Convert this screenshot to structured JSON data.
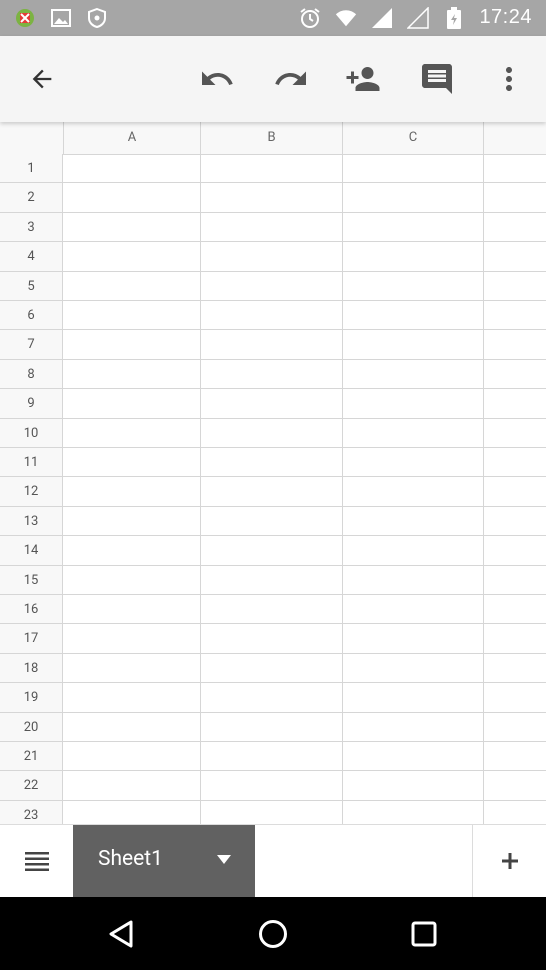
{
  "status_bar": {
    "time": "17:24",
    "left_icons": [
      "app-notification-icon",
      "image-notification-icon",
      "shield-notification-icon"
    ],
    "right_icons": [
      "alarm-icon",
      "wifi-icon",
      "signal-icon",
      "battery-icon"
    ]
  },
  "toolbar": {
    "icons": [
      "back-arrow-icon",
      "undo-icon",
      "redo-icon",
      "add-person-icon",
      "comment-icon",
      "more-vert-icon"
    ]
  },
  "sheet": {
    "columns": [
      "A",
      "B",
      "C",
      ""
    ],
    "rows": [
      "1",
      "2",
      "3",
      "4",
      "5",
      "6",
      "7",
      "8",
      "9",
      "10",
      "11",
      "12",
      "13",
      "14",
      "15",
      "16",
      "17",
      "18",
      "19",
      "20",
      "21",
      "22",
      "23"
    ]
  },
  "bottom_bar": {
    "sheet_tab_label": "Sheet1",
    "add_label": "+"
  },
  "colors": {
    "status_bar": "#a6a6a6",
    "toolbar_bg": "#f5f5f5",
    "active_tab": "#616161",
    "grid_line": "#d6d6d6",
    "nav_bar": "#000000"
  }
}
